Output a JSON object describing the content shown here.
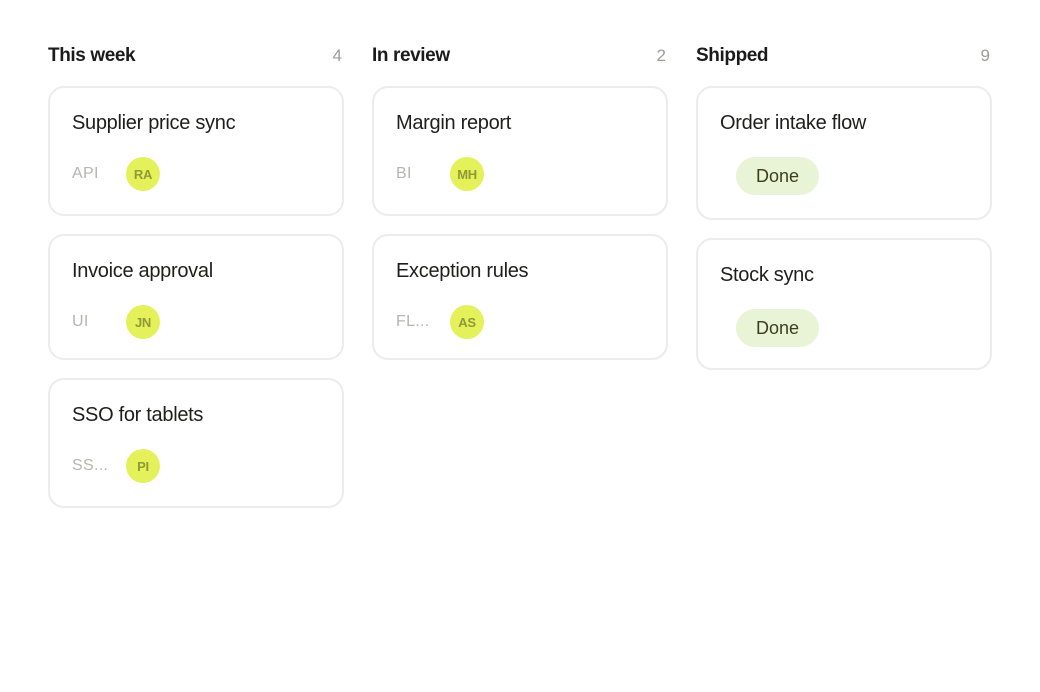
{
  "columns": [
    {
      "title": "This week",
      "count": "4",
      "cards": [
        {
          "title": "Supplier price sync",
          "tag": "API",
          "avatar": "RA"
        },
        {
          "title": "Invoice approval",
          "tag": "UI",
          "avatar": "JN"
        },
        {
          "title": "SSO for tablets",
          "tag": "SS...",
          "avatar": "PI"
        }
      ]
    },
    {
      "title": "In review",
      "count": "2",
      "cards": [
        {
          "title": "Margin report",
          "tag": "BI",
          "avatar": "MH"
        },
        {
          "title": "Exception rules",
          "tag": "FL...",
          "avatar": "AS"
        }
      ]
    },
    {
      "title": "Shipped",
      "count": "9",
      "cards": [
        {
          "title": "Order intake flow",
          "status": "Done"
        },
        {
          "title": "Stock sync",
          "status": "Done"
        }
      ]
    }
  ],
  "colors": {
    "avatar_bg": "#e4f15a",
    "done_badge_bg": "#e9f3d5",
    "card_border": "#ececec"
  }
}
